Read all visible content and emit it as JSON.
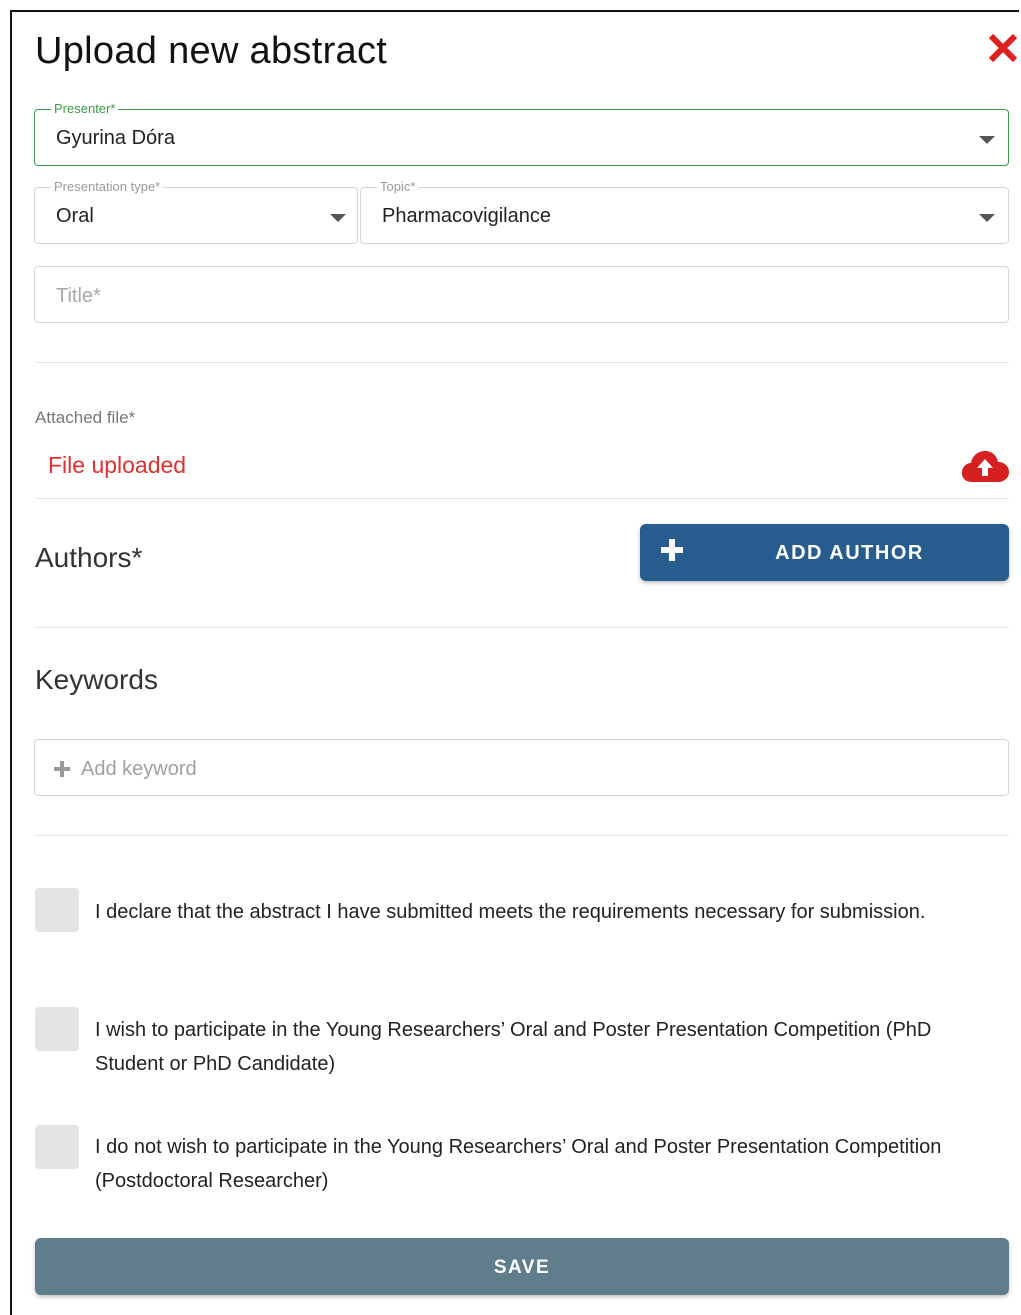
{
  "modal": {
    "title": "Upload new abstract"
  },
  "presenter": {
    "legend": "Presenter*",
    "value": "Gyurina Dóra"
  },
  "presentation_type": {
    "legend": "Presentation type*",
    "value": "Oral"
  },
  "topic": {
    "legend": "Topic*",
    "value": "Pharmacovigilance"
  },
  "title_field": {
    "placeholder": "Title*"
  },
  "attached_file": {
    "label": "Attached file*",
    "status": "File uploaded"
  },
  "authors": {
    "heading": "Authors*",
    "add_label": "ADD AUTHOR"
  },
  "keywords": {
    "heading": "Keywords",
    "placeholder": "Add keyword"
  },
  "declarations": [
    {
      "text": "I declare that the abstract I have submitted meets the requirements necessary for submission."
    },
    {
      "text": "I wish to participate in the Young Researchers’ Oral and Poster Presentation Competition (PhD Student or PhD Candidate)"
    },
    {
      "text": "I do not wish to participate in the Young Researchers’ Oral and Poster Presentation Competition (Postdoctoral Researcher)"
    }
  ],
  "save_label": "SAVE",
  "colors": {
    "accent_green": "#3a9a4a",
    "primary_blue": "#265c8e",
    "save_gray": "#607d8b",
    "error_red": "#e03030"
  },
  "icons": {
    "close": "close-icon",
    "dropdown": "chevron-down-icon",
    "upload": "cloud-upload-icon",
    "add": "plus-icon"
  }
}
